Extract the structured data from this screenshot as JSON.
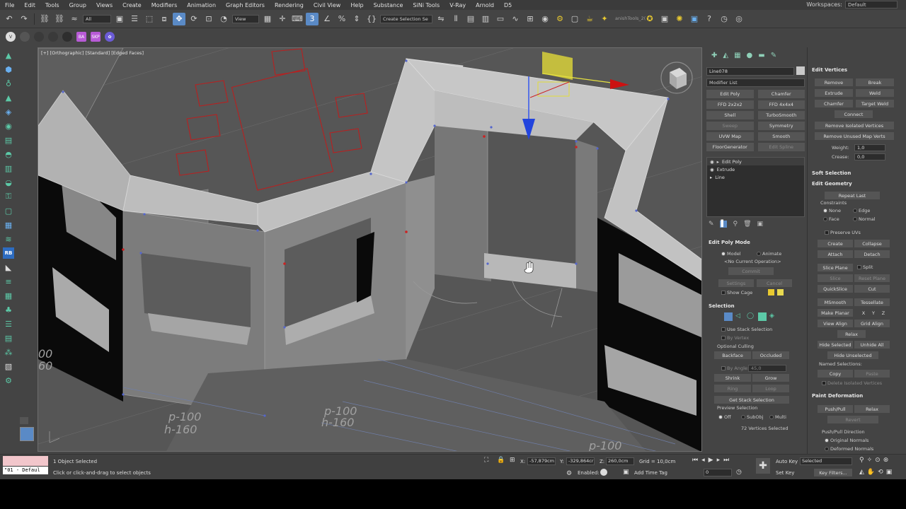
{
  "menubar": {
    "items": [
      "File",
      "Edit",
      "Tools",
      "Group",
      "Views",
      "Create",
      "Modifiers",
      "Animation",
      "Graph Editors",
      "Rendering",
      "Civil View",
      "Help",
      "Substance",
      "SiNi Tools",
      "V-Ray",
      "Arnold",
      "D5"
    ],
    "workspaces_label": "Workspaces:",
    "workspace_value": "Default"
  },
  "toolbar": {
    "filter_value": "All",
    "view_value": "View",
    "selection_set_placeholder": "Create Selection Se",
    "anish_label": "anishTools_2("
  },
  "viewport": {
    "label": "[+] [Orthographic] [Standard] [Edged Faces]",
    "annotations": [
      "p-100",
      "h-160",
      "p-100",
      "h-160",
      "p-100",
      "00",
      "60"
    ]
  },
  "command_panel": {
    "object_name": "Line078",
    "modifier_list": "Modifier List",
    "modifier_buttons": [
      {
        "label": "Edit Poly",
        "dim": false
      },
      {
        "label": "Chamfer",
        "dim": false
      },
      {
        "label": "FFD 2x2x2",
        "dim": false
      },
      {
        "label": "FFD 4x4x4",
        "dim": false
      },
      {
        "label": "Shell",
        "dim": false
      },
      {
        "label": "TurboSmooth",
        "dim": false
      },
      {
        "label": "Sweep",
        "dim": true
      },
      {
        "label": "Symmetry",
        "dim": false
      },
      {
        "label": "UVW Map",
        "dim": false
      },
      {
        "label": "Smooth",
        "dim": false
      },
      {
        "label": "FloorGenerator",
        "dim": false
      },
      {
        "label": "Edit Spline",
        "dim": true
      }
    ],
    "stack": [
      "Edit Poly",
      "Extrude",
      "Line"
    ],
    "edit_poly_mode": {
      "title": "Edit Poly Mode",
      "model": "Model",
      "animate": "Animate",
      "operation": "<No Current Operation>",
      "commit": "Commit",
      "settings": "Settings",
      "cancel": "Cancel",
      "show_cage": "Show Cage"
    },
    "selection": {
      "title": "Selection",
      "use_stack": "Use Stack Selection",
      "by_vertex": "By Vertex",
      "optional_culling": "Optional Culling",
      "backface": "Backface",
      "occluded": "Occluded",
      "by_angle": "By Angle:",
      "by_angle_value": "45,0",
      "shrink": "Shrink",
      "grow": "Grow",
      "ring": "Ring",
      "loop": "Loop",
      "get_stack": "Get Stack Selection",
      "preview": "Preview Selection",
      "off": "Off",
      "subobj": "SubObj",
      "multi": "Multi",
      "count": "72 Vertices Selected"
    }
  },
  "modify_panel": {
    "edit_vertices": {
      "title": "Edit Vertices",
      "remove": "Remove",
      "break": "Break",
      "extrude": "Extrude",
      "weld": "Weld",
      "chamfer": "Chamfer",
      "target_weld": "Target Weld",
      "connect": "Connect",
      "remove_isolated": "Remove Isolated Vertices",
      "remove_unused": "Remove Unused Map Verts",
      "weight_label": "Weight:",
      "weight_value": "1,0",
      "crease_label": "Crease:",
      "crease_value": "0,0"
    },
    "soft_selection": "Soft Selection",
    "edit_geometry": {
      "title": "Edit Geometry",
      "repeat_last": "Repeat Last",
      "constraints": "Constraints",
      "none": "None",
      "edge": "Edge",
      "face": "Face",
      "normal": "Normal",
      "preserve_uvs": "Preserve UVs",
      "create": "Create",
      "collapse": "Collapse",
      "attach": "Attach",
      "detach": "Detach",
      "slice_plane": "Slice Plane",
      "split": "Split",
      "slice": "Slice",
      "reset_plane": "Reset Plane",
      "quickslice": "QuickSlice",
      "cut": "Cut",
      "msmooth": "MSmooth",
      "tessellate": "Tessellate",
      "make_planar": "Make Planar",
      "x": "X",
      "y": "Y",
      "z": "Z",
      "view_align": "View Align",
      "grid_align": "Grid Align",
      "relax": "Relax",
      "hide_selected": "Hide Selected",
      "unhide_all": "Unhide All",
      "hide_unselected": "Hide Unselected",
      "named_selections": "Named Selections:",
      "copy": "Copy",
      "paste": "Paste",
      "delete_isolated": "Delete Isolated Vertices"
    },
    "paint_deformation": {
      "title": "Paint Deformation",
      "push_pull": "Push/Pull",
      "relax": "Relax",
      "revert": "Revert",
      "direction": "Push/Pull Direction",
      "original": "Original Normals",
      "deformed": "Deformed Normals"
    }
  },
  "statusbar": {
    "material_label": "\"01 - Defaul",
    "objects_selected": "1 Object Selected",
    "prompt": "Click or click-and-drag to select objects",
    "x_label": "X:",
    "x_value": "-57,879cm",
    "y_label": "Y:",
    "y_value": "-329,864cr",
    "z_label": "Z:",
    "z_value": "260,0cm",
    "grid": "Grid = 10,0cm",
    "enabled": "Enabled:",
    "add_time_tag": "Add Time Tag",
    "auto_key": "Auto Key",
    "set_key": "Set Key",
    "selected_value": "Selected",
    "key_filters": "Key Filters...",
    "frame_value": "0"
  },
  "colors": {
    "bg": "#444444",
    "viewport_bg": "#555555",
    "wall_light": "#a7a7a7",
    "wall_dark": "#787878",
    "red_outline": "#c02020",
    "accent_blue": "#5a8ac6"
  }
}
